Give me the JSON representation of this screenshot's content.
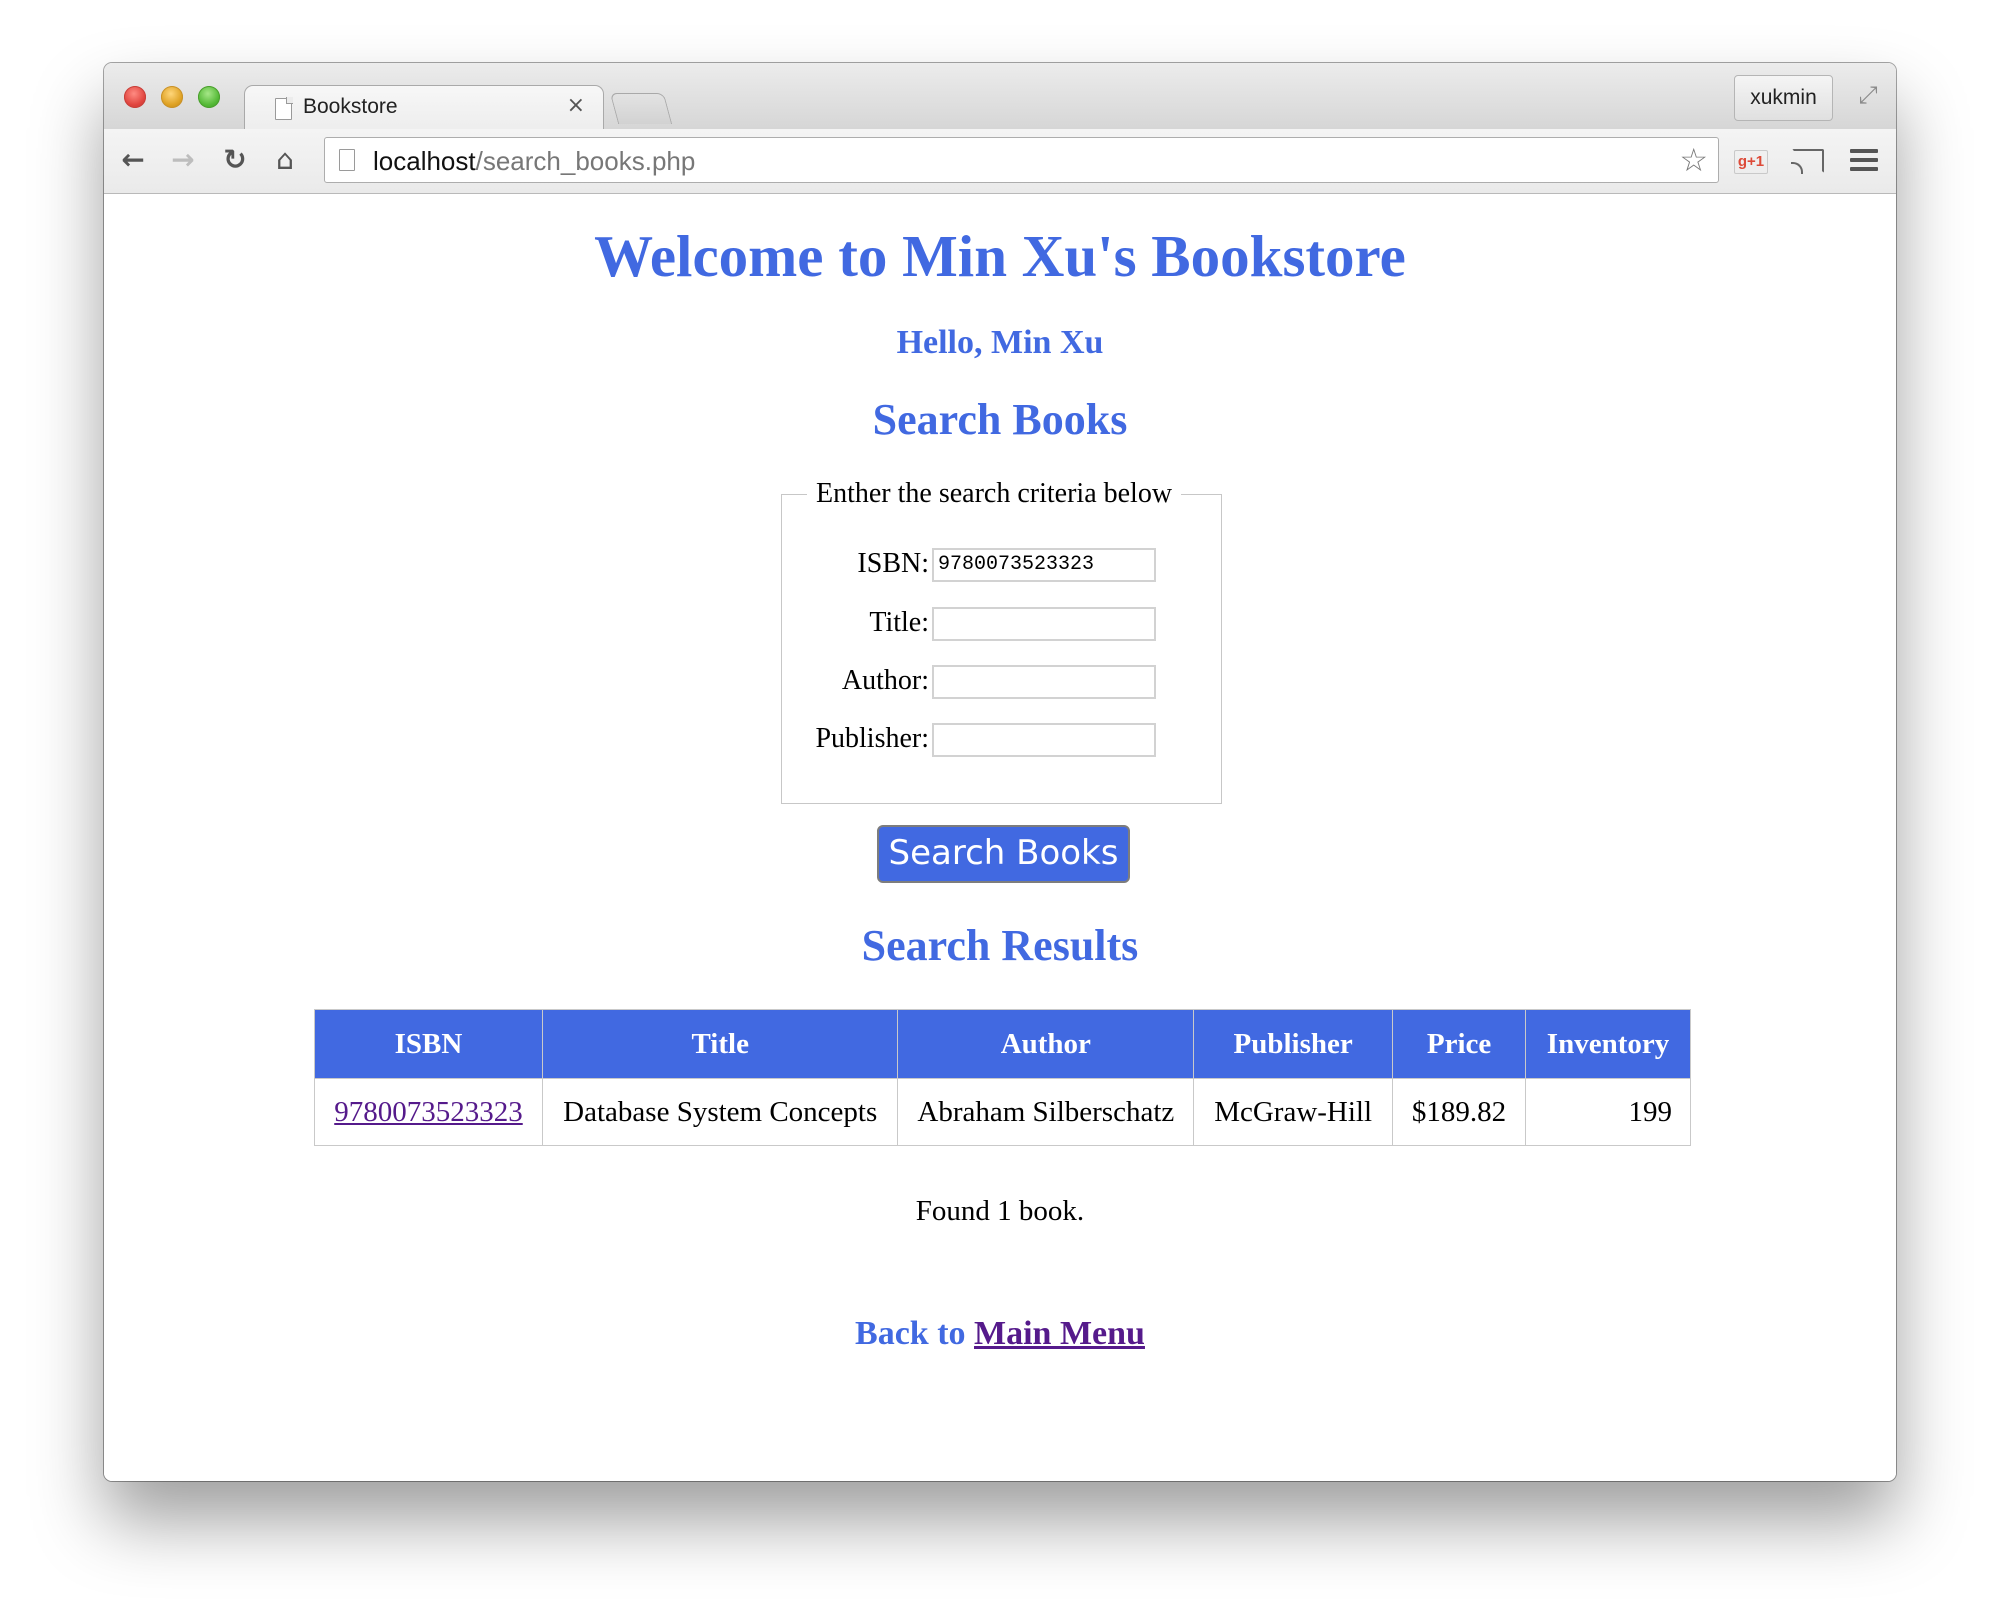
{
  "browser": {
    "tab_title": "Bookstore",
    "tab_close": "×",
    "profile_name": "xukmin",
    "url_host": "localhost",
    "url_path": "/search_books.php",
    "gplus_label": "g+1",
    "icons": {
      "back": "arrow-left",
      "forward": "arrow-right",
      "reload": "reload",
      "home": "home",
      "star": "star",
      "fullscreen": "fullscreen"
    }
  },
  "page": {
    "title": "Welcome to Min Xu's Bookstore",
    "greeting": "Hello, Min Xu",
    "search_heading": "Search Books",
    "criteria_legend": "Enther the search criteria below",
    "fields": [
      {
        "label": "ISBN:",
        "value": "9780073523323"
      },
      {
        "label": "Title:",
        "value": ""
      },
      {
        "label": "Author:",
        "value": ""
      },
      {
        "label": "Publisher:",
        "value": ""
      }
    ],
    "search_button": "Search Books",
    "results_heading": "Search Results",
    "table": {
      "headers": [
        "ISBN",
        "Title",
        "Author",
        "Publisher",
        "Price",
        "Inventory"
      ],
      "rows": [
        [
          "9780073523323",
          "Database System Concepts",
          "Abraham Silberschatz",
          "McGraw-Hill",
          "$189.82",
          "199"
        ]
      ]
    },
    "found_text": "Found 1 book.",
    "back_prefix": "Back to",
    "back_link": "Main Menu"
  },
  "colors": {
    "accent": "#4169e1",
    "visited_link": "#551a8b"
  }
}
